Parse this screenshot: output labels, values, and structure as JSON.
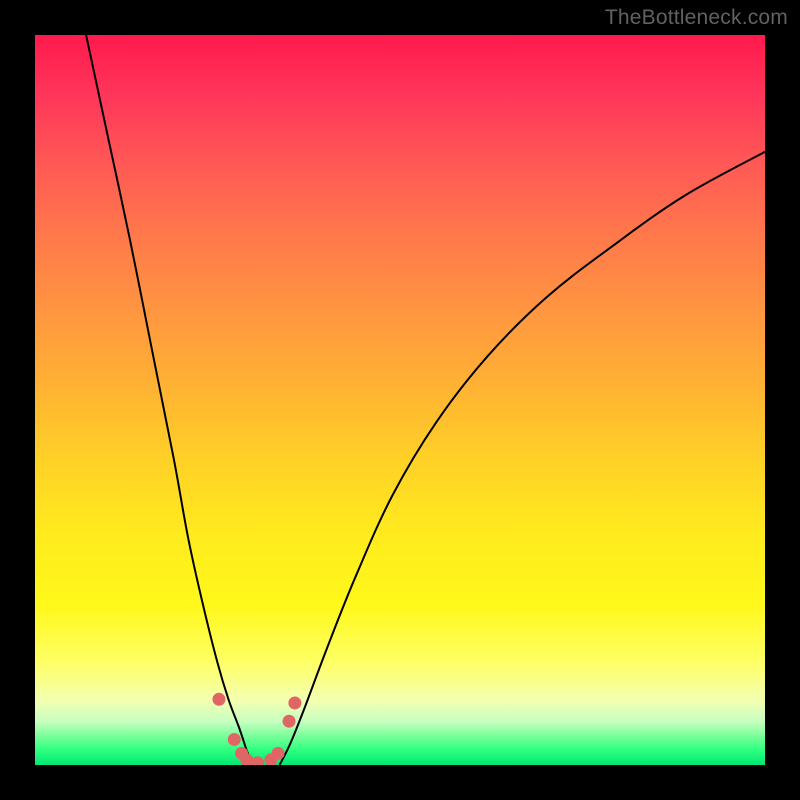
{
  "watermark": "TheBottleneck.com",
  "chart_data": {
    "type": "line",
    "title": "",
    "xlabel": "",
    "ylabel": "",
    "xlim": [
      0,
      100
    ],
    "ylim": [
      0,
      100
    ],
    "gradient_bands": [
      {
        "name": "red",
        "approx_y_pct_from_top": 0
      },
      {
        "name": "orange",
        "approx_y_pct_from_top": 40
      },
      {
        "name": "yellow",
        "approx_y_pct_from_top": 72
      },
      {
        "name": "light",
        "approx_y_pct_from_top": 90
      },
      {
        "name": "green",
        "approx_y_pct_from_top": 100
      }
    ],
    "series": [
      {
        "name": "left-branch",
        "x": [
          7,
          10,
          13,
          16,
          19,
          21,
          23,
          25,
          26.5,
          28,
          29,
          29.8
        ],
        "y": [
          100,
          86,
          72,
          57,
          42,
          31,
          22,
          14,
          9,
          5,
          2,
          0
        ]
      },
      {
        "name": "right-branch",
        "x": [
          33.5,
          35,
          37,
          40,
          44,
          49,
          55,
          62,
          70,
          79,
          89,
          100
        ],
        "y": [
          0,
          3,
          8,
          16,
          26,
          37,
          47,
          56,
          64,
          71,
          78,
          84
        ]
      }
    ],
    "markers": [
      {
        "x": 25.2,
        "y": 9.0
      },
      {
        "x": 27.3,
        "y": 3.5
      },
      {
        "x": 28.3,
        "y": 1.6
      },
      {
        "x": 29.0,
        "y": 0.7
      },
      {
        "x": 30.5,
        "y": 0.3
      },
      {
        "x": 32.3,
        "y": 0.7
      },
      {
        "x": 33.3,
        "y": 1.6
      },
      {
        "x": 34.8,
        "y": 6.0
      },
      {
        "x": 35.6,
        "y": 8.5
      }
    ],
    "marker_color": "#e06666",
    "curve_color": "#000000"
  }
}
